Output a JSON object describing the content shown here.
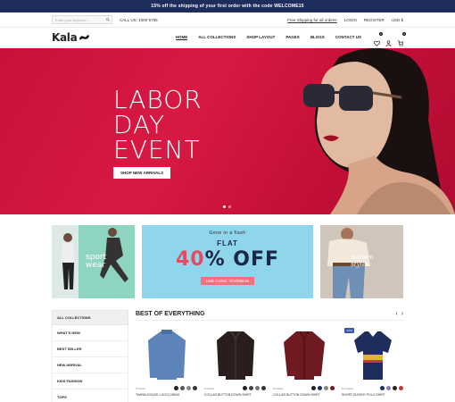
{
  "topbar": {
    "text": "15% off the shipping of your first order with the code WELCOME15"
  },
  "util": {
    "search_placeholder": "Enter your keyword ...",
    "phone": "CALL US: 1000-5785",
    "shipping": "Free Shipping for all orders!",
    "login": "LOGIN",
    "register": "REGISTER",
    "currency": "USD $"
  },
  "nav": {
    "logo": "Kala",
    "items": [
      "HOME",
      "ALL COLLECTIONS",
      "SHOP LAYOUT",
      "PAGES",
      "BLOGS",
      "CONTACT US"
    ],
    "wishlist_count": "0",
    "cart_count": "0"
  },
  "hero": {
    "line1": "LABOR",
    "line2": "DAY",
    "line3": "EVENT",
    "button": "SHOP NEW ARRIVALS"
  },
  "promos": {
    "sport": {
      "line1": "sport",
      "line2": "wear"
    },
    "sale": {
      "top": "Gone in a flash",
      "flat": "FLAT",
      "big": "40",
      "big_suffix": "% OFF",
      "code": "USE CODE: GIVEME40"
    },
    "women": {
      "line1": "women",
      "line2": "styles"
    }
  },
  "sidebar": {
    "header": "ALL COLLECTIONS",
    "items": [
      "WHAT'S NEW",
      "BEST SELLER",
      "NEW ARRIVAL",
      "KIDS FASHION",
      "TOPS"
    ]
  },
  "best": {
    "title": "BEST OF EVERYTHING",
    "products": [
      {
        "colors_label": "5 Colors",
        "name": "TWINKLEGAGE LOGO LINING"
      },
      {
        "colors_label": "5 Colors",
        "name": "COLLAR BUTTON DOWN SHIRT"
      },
      {
        "colors_label": "5 Colors",
        "name": "COLLAR BUTTON DOWN SHIRT"
      },
      {
        "colors_label": "10 Colors",
        "name": "SHORT SLEEVE POLO SHIRT",
        "badge": "-10%"
      }
    ]
  }
}
